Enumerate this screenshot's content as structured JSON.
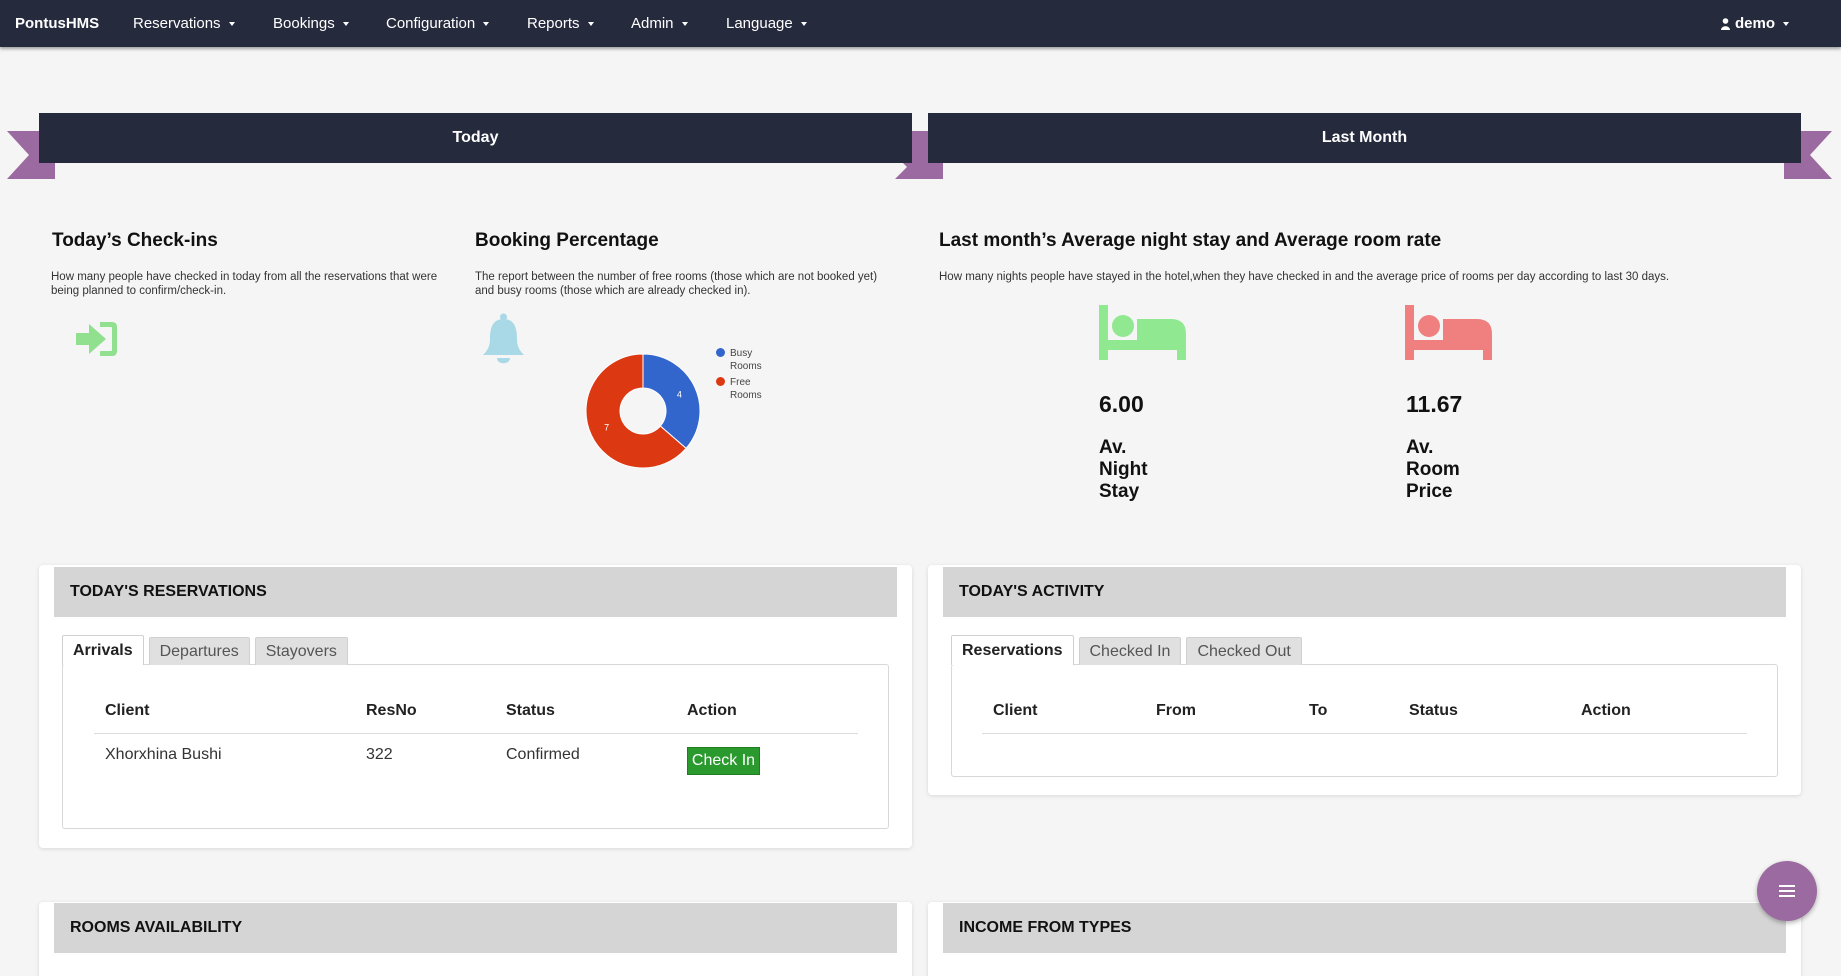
{
  "nav": {
    "brand": "PontusHMS",
    "items": [
      "Reservations",
      "Bookings",
      "Configuration",
      "Reports",
      "Admin",
      "Language"
    ],
    "user": "demo"
  },
  "ribbons": {
    "today": "Today",
    "last_month": "Last Month"
  },
  "checkins": {
    "title": "Today’s Check-ins",
    "desc_line1": "How many people have checked in today from all the reservations that were",
    "desc_line2": "being planned to confirm/check-in."
  },
  "booking": {
    "title": "Booking Percentage",
    "desc_line1": "The report between the number of free rooms (those which are not booked yet)",
    "desc_line2": "and busy rooms (those which are already checked in)."
  },
  "chart_data": {
    "type": "pie",
    "title": "",
    "categories": [
      "Busy Rooms",
      "Free Rooms"
    ],
    "values": [
      4,
      7
    ],
    "colors": [
      "#3366cc",
      "#dc3912"
    ],
    "legend_position": "right",
    "donut": true
  },
  "legend": {
    "busy_1": "Busy",
    "busy_2": "Rooms",
    "free_1": "Free",
    "free_2": "Rooms"
  },
  "last_month": {
    "title": "Last month’s Average night stay and Average room rate",
    "desc": "How many nights people have stayed in the hotel,when they have checked in and the average price of rooms per day according to last 30 days.",
    "night_value": "6.00",
    "night_l1": "Av.",
    "night_l2": "Night",
    "night_l3": "Stay",
    "price_value": "11.67",
    "price_l1": "Av.",
    "price_l2": "Room",
    "price_l3": "Price"
  },
  "reservations": {
    "header": "TODAY'S RESERVATIONS",
    "tabs": [
      "Arrivals",
      "Departures",
      "Stayovers"
    ],
    "columns": [
      "Client",
      "ResNo",
      "Status",
      "Action"
    ],
    "rows": [
      {
        "client": "Xhorxhina Bushi",
        "resno": "322",
        "status": "Confirmed",
        "action": "Check In"
      }
    ]
  },
  "activity": {
    "header": "TODAY'S ACTIVITY",
    "tabs": [
      "Reservations",
      "Checked In",
      "Checked Out"
    ],
    "columns": [
      "Client",
      "From",
      "To",
      "Status",
      "Action"
    ]
  },
  "rooms_header": "ROOMS AVAILABILITY",
  "income_header": "INCOME FROM TYPES",
  "colors": {
    "navbar": "#262a3d",
    "ribbon_tail": "#9b6aa0",
    "checkin_icon": "#90e090",
    "bell_icon": "#a9d8e6",
    "bed_green": "#90e890",
    "bed_red": "#f08080",
    "check_in_button": "#2a9a2e"
  }
}
